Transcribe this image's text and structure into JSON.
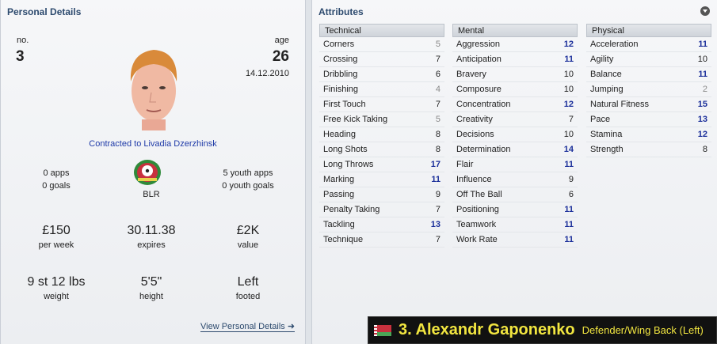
{
  "personal": {
    "title": "Personal Details",
    "number_label": "no.",
    "number": "3",
    "age_label": "age",
    "age": "26",
    "birth_date": "14.12.2010",
    "contract": "Contracted to Livadia Dzerzhinsk",
    "apps": "0 apps",
    "goals": "0 goals",
    "nation": "BLR",
    "youth_apps": "5 youth apps",
    "youth_goals": "0 youth goals",
    "wage": "£150",
    "wage_label": "per week",
    "expires": "30.11.38",
    "expires_label": "expires",
    "value": "£2K",
    "value_label": "value",
    "weight": "9 st 12 lbs",
    "weight_label": "weight",
    "height": "5'5\"",
    "height_label": "height",
    "foot": "Left",
    "foot_label": "footed",
    "view_link": "View Personal Details ➜"
  },
  "attributes": {
    "title": "Attributes",
    "technical": {
      "header": "Technical",
      "items": [
        {
          "name": "Corners",
          "value": 5
        },
        {
          "name": "Crossing",
          "value": 7
        },
        {
          "name": "Dribbling",
          "value": 6
        },
        {
          "name": "Finishing",
          "value": 4
        },
        {
          "name": "First Touch",
          "value": 7
        },
        {
          "name": "Free Kick Taking",
          "value": 5
        },
        {
          "name": "Heading",
          "value": 8
        },
        {
          "name": "Long Shots",
          "value": 8
        },
        {
          "name": "Long Throws",
          "value": 17
        },
        {
          "name": "Marking",
          "value": 11
        },
        {
          "name": "Passing",
          "value": 9
        },
        {
          "name": "Penalty Taking",
          "value": 7
        },
        {
          "name": "Tackling",
          "value": 13
        },
        {
          "name": "Technique",
          "value": 7
        }
      ]
    },
    "mental": {
      "header": "Mental",
      "items": [
        {
          "name": "Aggression",
          "value": 12
        },
        {
          "name": "Anticipation",
          "value": 11
        },
        {
          "name": "Bravery",
          "value": 10
        },
        {
          "name": "Composure",
          "value": 10
        },
        {
          "name": "Concentration",
          "value": 12
        },
        {
          "name": "Creativity",
          "value": 7
        },
        {
          "name": "Decisions",
          "value": 10
        },
        {
          "name": "Determination",
          "value": 14
        },
        {
          "name": "Flair",
          "value": 11
        },
        {
          "name": "Influence",
          "value": 9
        },
        {
          "name": "Off The Ball",
          "value": 6
        },
        {
          "name": "Positioning",
          "value": 11
        },
        {
          "name": "Teamwork",
          "value": 11
        },
        {
          "name": "Work Rate",
          "value": 11
        }
      ]
    },
    "physical": {
      "header": "Physical",
      "items": [
        {
          "name": "Acceleration",
          "value": 11
        },
        {
          "name": "Agility",
          "value": 10
        },
        {
          "name": "Balance",
          "value": 11
        },
        {
          "name": "Jumping",
          "value": 2
        },
        {
          "name": "Natural Fitness",
          "value": 15
        },
        {
          "name": "Pace",
          "value": 13
        },
        {
          "name": "Stamina",
          "value": 12
        },
        {
          "name": "Strength",
          "value": 8
        }
      ]
    }
  },
  "banner": {
    "name": "3. Alexandr Gaponenko",
    "position": "Defender/Wing Back (Left)"
  }
}
